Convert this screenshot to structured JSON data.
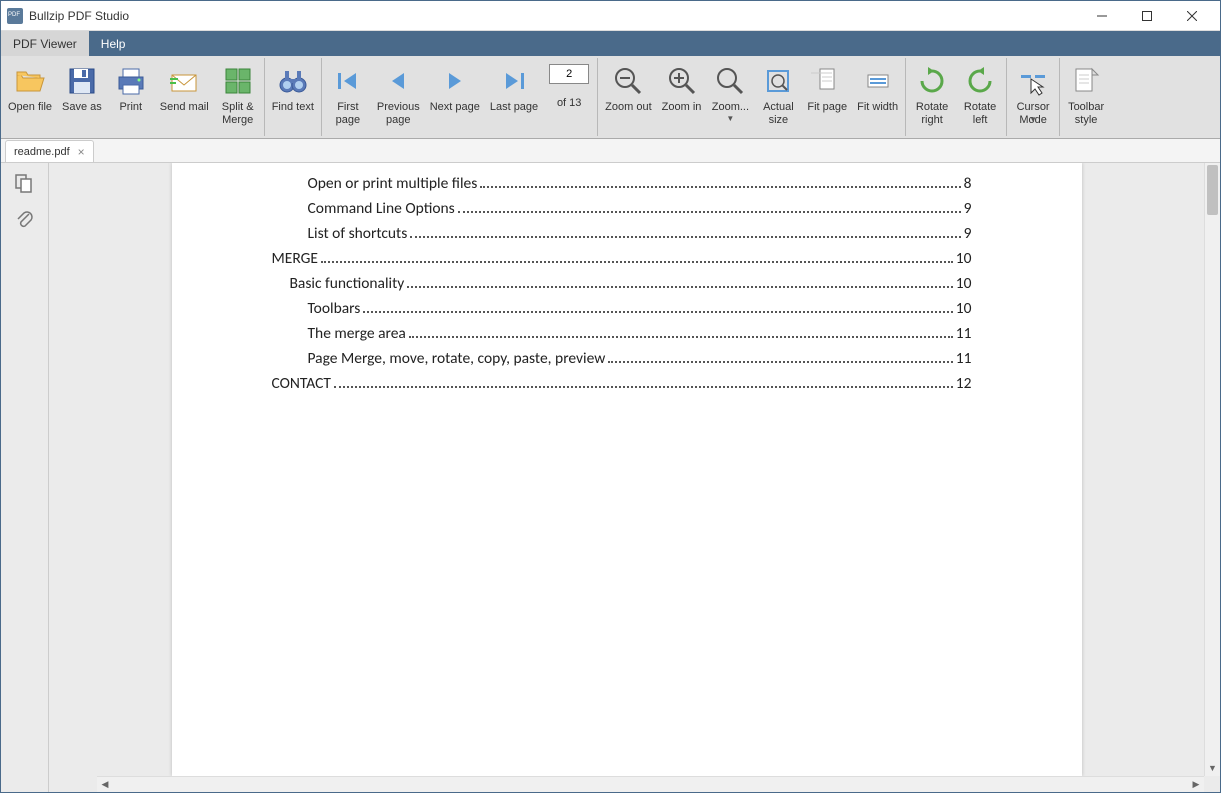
{
  "window": {
    "title": "Bullzip PDF Studio"
  },
  "menu": {
    "pdf_viewer": "PDF Viewer",
    "help": "Help"
  },
  "toolbar": {
    "open_file": "Open file",
    "save_as": "Save as",
    "print": "Print",
    "send_mail": "Send mail",
    "split_merge": "Split &\nMerge",
    "find_text": "Find text",
    "first_page": "First\npage",
    "previous_page": "Previous\npage",
    "next_page": "Next page",
    "last_page": "Last page",
    "current_page": "2",
    "page_count_label": "of 13",
    "zoom_out": "Zoom out",
    "zoom_in": "Zoom in",
    "zoom": "Zoom...",
    "actual_size": "Actual\nsize",
    "fit_page": "Fit page",
    "fit_width": "Fit width",
    "rotate_right": "Rotate\nright",
    "rotate_left": "Rotate\nleft",
    "cursor_mode": "Cursor\nMode",
    "toolbar_style": "Toolbar\nstyle"
  },
  "tab": {
    "name": "readme.pdf"
  },
  "toc": [
    {
      "level": 3,
      "text": "Open or print multiple files",
      "page": "8"
    },
    {
      "level": 3,
      "text": "Command Line Options",
      "page": "9"
    },
    {
      "level": 3,
      "text": "List of shortcuts",
      "page": "9"
    },
    {
      "level": 1,
      "text": "MERGE",
      "page": "10"
    },
    {
      "level": 2,
      "text": "Basic functionality",
      "page": "10"
    },
    {
      "level": 3,
      "text": "Toolbars",
      "page": "10"
    },
    {
      "level": 3,
      "text": "The merge area",
      "page": "11"
    },
    {
      "level": 3,
      "text": "Page Merge, move, rotate, copy, paste, preview",
      "page": "11"
    },
    {
      "level": 1,
      "text": "CONTACT",
      "page": "12"
    }
  ]
}
